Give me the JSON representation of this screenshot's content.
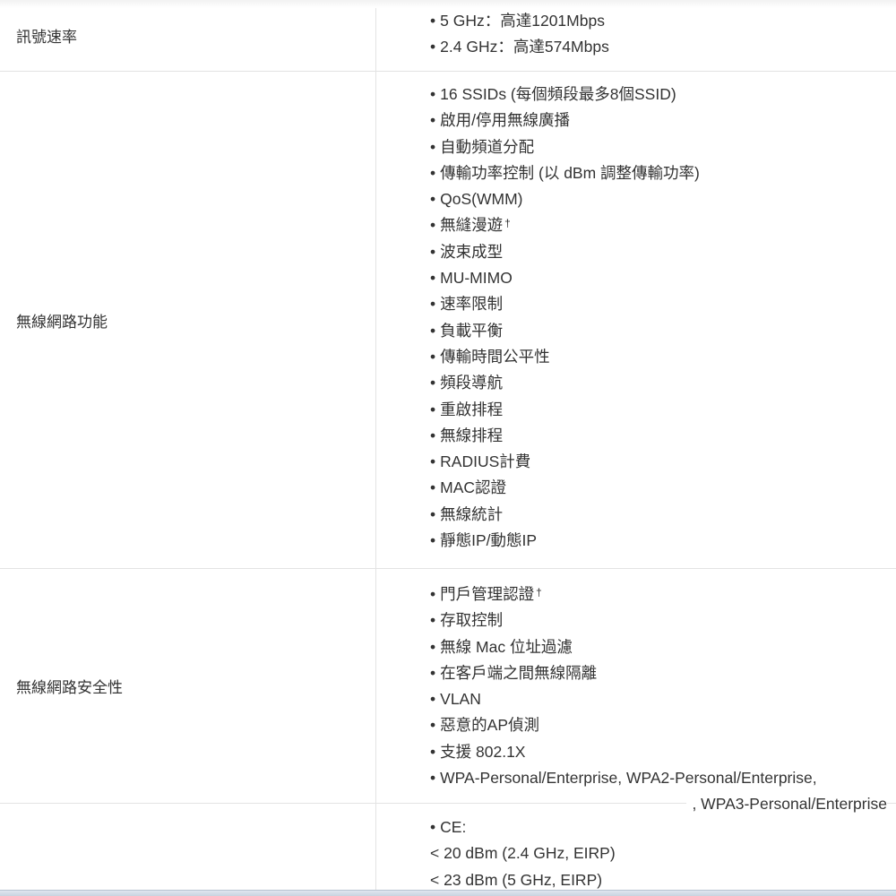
{
  "rows": [
    {
      "label": "訊號速率",
      "items": [
        "5 GHz：高達1201Mbps",
        "2.4 GHz：高達574Mbps"
      ]
    },
    {
      "label": "無線網路功能",
      "items": [
        "16 SSIDs (每個頻段最多8個SSID)",
        "啟用/停用無線廣播",
        "自動頻道分配",
        "傳輸功率控制 (以 dBm 調整傳輸功率)",
        "QoS(WMM)",
        "無縫漫遊",
        "波束成型",
        "MU-MIMO",
        "速率限制",
        "負載平衡",
        "傳輸時間公平性",
        "頻段導航",
        "重啟排程",
        "無線排程",
        "RADIUS計費",
        "MAC認證",
        "無線統計",
        "靜態IP/動態IP"
      ]
    },
    {
      "label": "無線網路安全性",
      "items": [
        "門戶管理認證",
        "存取控制",
        "無線 Mac 位址過濾",
        "在客戶端之間無線隔離",
        "VLAN",
        "惡意的AP偵測",
        "支援 802.1X",
        "WPA-Personal/Enterprise, WPA2-Personal/Enterprise,"
      ],
      "continuation": ", WPA3-Personal/Enterprise"
    },
    {
      "label": "",
      "items": [
        "CE:",
        "< 20 dBm (2.4 GHz, EIRP)",
        "< 23 dBm (5 GHz, EIRP)"
      ]
    }
  ],
  "dagger": "†",
  "bullet": "•"
}
